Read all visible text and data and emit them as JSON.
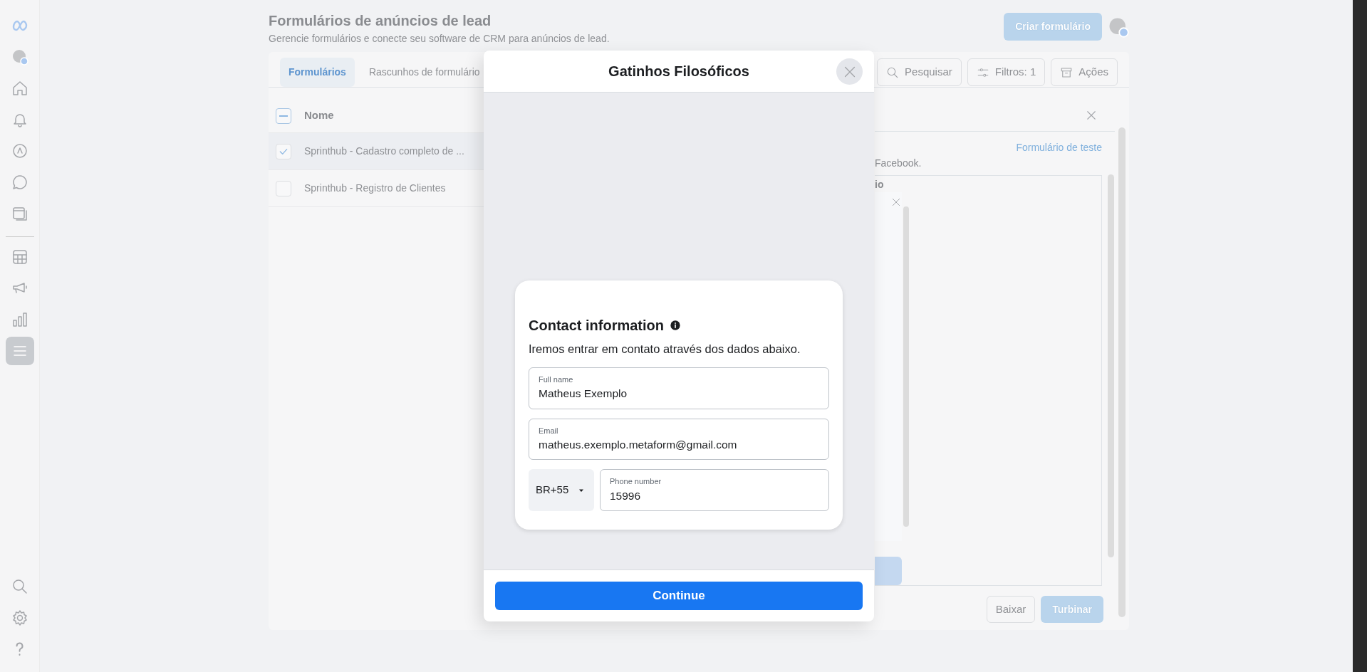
{
  "sidebar": {
    "sections": [
      {
        "items": [
          {
            "kind": "logo",
            "selected": false
          },
          {
            "kind": "avatar",
            "selected": false
          },
          {
            "kind": "home",
            "selected": false
          },
          {
            "kind": "bell",
            "selected": false
          },
          {
            "kind": "compass",
            "selected": false
          },
          {
            "kind": "chat",
            "selected": false
          },
          {
            "kind": "pages",
            "selected": false
          }
        ]
      },
      {
        "items": [
          {
            "kind": "table",
            "selected": false
          },
          {
            "kind": "megaphone",
            "selected": false
          },
          {
            "kind": "chart",
            "selected": false
          },
          {
            "kind": "menu",
            "selected": true
          }
        ]
      }
    ],
    "bottom_items": [
      {
        "kind": "search"
      },
      {
        "kind": "gear"
      },
      {
        "kind": "help"
      }
    ]
  },
  "header": {
    "title": "Formulários de anúncios de lead",
    "subtitle": "Gerencie formulários e conecte seu software de CRM para anúncios de lead.",
    "create_button": "Criar formulário"
  },
  "tabs": [
    {
      "label": "Formulários",
      "selected": true
    },
    {
      "label": "Rascunhos de formulário",
      "selected": false
    }
  ],
  "toolbar": {
    "search": "Pesquisar",
    "filters": "Filtros: 1",
    "actions": "Ações"
  },
  "table": {
    "columns": [
      "Nome"
    ],
    "select_all_indeterminate": true,
    "rows": [
      {
        "name": "Sprinthub - Cadastro completo de ...",
        "checked": true
      },
      {
        "name": "Sprinthub - Registro de Clientes",
        "checked": false
      }
    ]
  },
  "detail_panel": {
    "link": "Formulário de teste",
    "text": "Facebook.",
    "section_label": "io"
  },
  "footer_buttons": [
    {
      "label": "Baixar",
      "kind": "secondary"
    },
    {
      "label": "Turbinar",
      "kind": "primary"
    }
  ],
  "modal": {
    "title": "Gatinhos Filosóficos",
    "card": {
      "heading": "Contact information",
      "description": "Iremos entrar em contato através dos dados abaixo.",
      "fields": [
        {
          "kind": "text",
          "label": "Full name",
          "value": "Matheus Exemplo"
        },
        {
          "kind": "text",
          "label": "Email",
          "value": "matheus.exemplo.metaform@gmail.com"
        },
        {
          "kind": "phone",
          "country": "BR+55",
          "label": "Phone number",
          "value": "15996"
        }
      ]
    },
    "button": "Continue"
  }
}
